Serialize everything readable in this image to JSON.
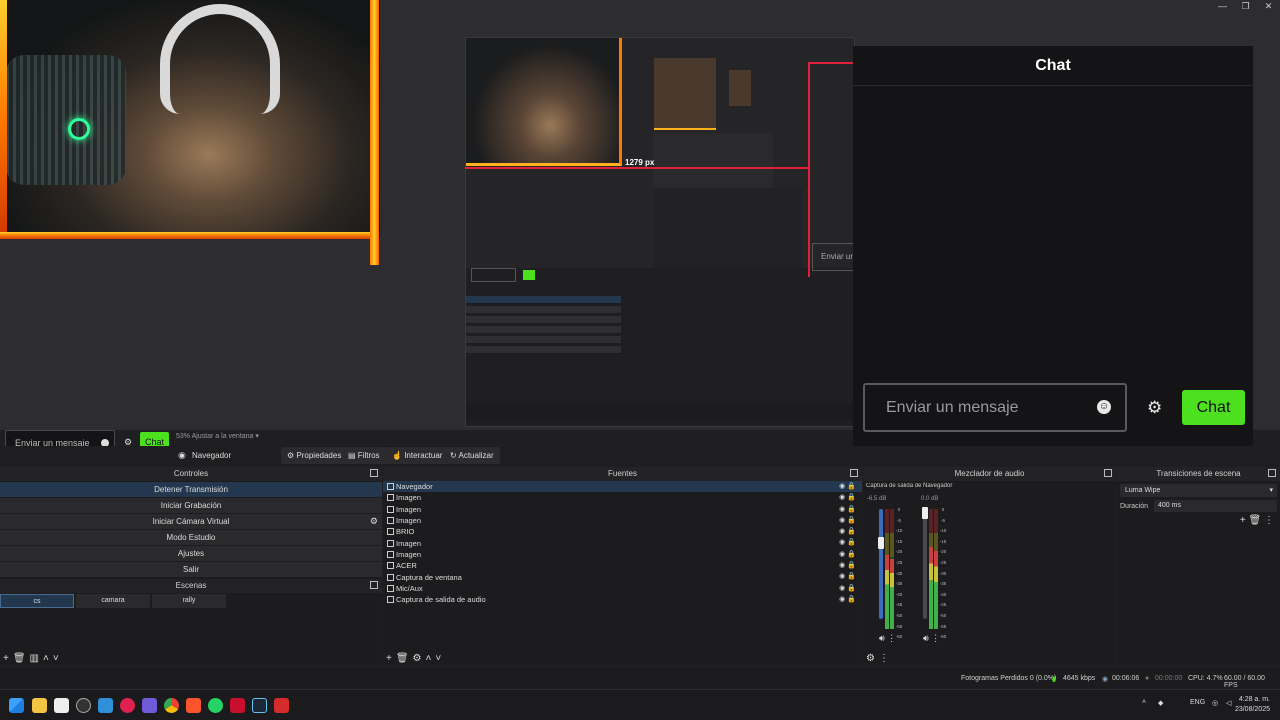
{
  "window_controls": {
    "minimize": "—",
    "restore": "❐",
    "close": "✕"
  },
  "preview": {
    "nested_resolution": "1279 px",
    "zoom_label": "53% Ajustar a la ventana"
  },
  "chat_overlay": {
    "title": "Chat",
    "input_placeholder": "Enviar un mensaje",
    "button": "Chat",
    "small_input_placeholder": "Enviar un mensaje",
    "small_button": "Chat"
  },
  "source_toolbar": {
    "current_source": "Navegador",
    "buttons": [
      "Propiedades",
      "Filtros",
      "Interactuar",
      "Actualizar"
    ]
  },
  "controls_dock": {
    "title": "Controles",
    "buttons": [
      "Detener Transmisión",
      "Iniciar Grabación",
      "Iniciar Cámara Virtual",
      "Modo Estudio",
      "Ajustes",
      "Salir"
    ]
  },
  "scenes_dock": {
    "title": "Escenas",
    "scenes": [
      "cs",
      "camara",
      "rally"
    ]
  },
  "sources_dock": {
    "title": "Fuentes",
    "items": [
      "Navegador",
      "Imagen",
      "Imagen",
      "Imagen",
      "BRIO",
      "Imagen",
      "Imagen",
      "ACER",
      "Captura de ventana",
      "Mic/Aux",
      "Captura de salida de audio"
    ]
  },
  "mixer_dock": {
    "title": "Mezclador de audio",
    "channels": [
      {
        "name": "Captura de salida de audi",
        "db": "-6.5 dB"
      },
      {
        "name": "Navegador",
        "db": "0.0 dB"
      }
    ],
    "ticks": [
      "0",
      "-5",
      "-10",
      "-15",
      "-20",
      "-25",
      "-30",
      "-35",
      "-40",
      "-45",
      "-50",
      "-55",
      "-60"
    ]
  },
  "transitions_dock": {
    "title": "Transiciones de escena",
    "selected": "Luma Wipe",
    "duration_label": "Duración",
    "duration_value": "400 ms"
  },
  "status_bar": {
    "dropped_frames": "Fotogramas Perdidos 0 (0.0%)",
    "bitrate": "4645 kbps",
    "stream_time": "00:06:06",
    "rec_time": "00:00:00",
    "cpu": "CPU: 4.7%",
    "fps": "60.00 / 60.00 FPS"
  },
  "taskbar": {
    "lang": "ENG",
    "time": "4:28 a. m.",
    "date": "23/08/2025"
  },
  "colors": {
    "accent_green": "#4ce01f",
    "selection": "#23384f",
    "record_red": "#e0203a"
  }
}
